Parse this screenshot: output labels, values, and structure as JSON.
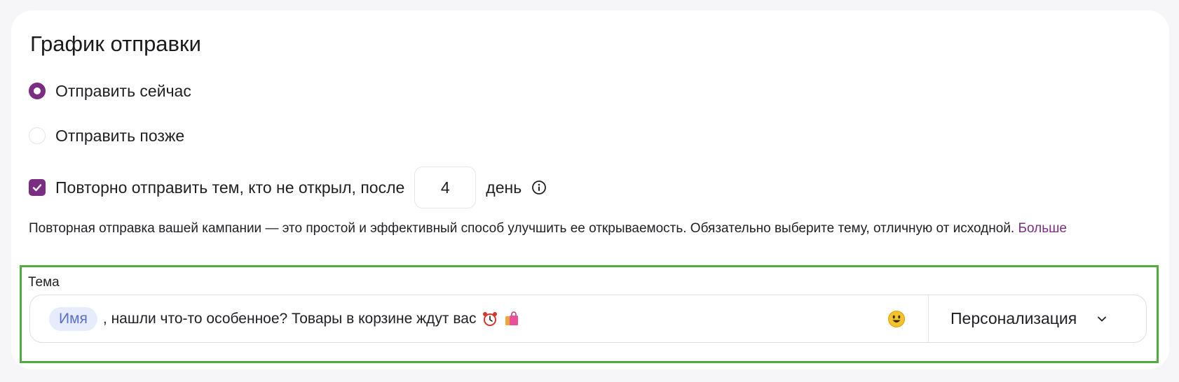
{
  "schedule": {
    "title": "График отправки",
    "options": [
      {
        "label": "Отправить сейчас",
        "selected": true
      },
      {
        "label": "Отправить позже",
        "selected": false
      }
    ]
  },
  "resend": {
    "checked": true,
    "label": "Повторно отправить тем, кто не открыл, после",
    "days_value": "4",
    "unit": "день",
    "icon": "info-icon",
    "description": "Повторная отправка вашей кампании — это простой и эффективный способ улучшить ее открываемость. Обязательно выберите тему, отличную от исходной.",
    "more_link": "Больше"
  },
  "subject": {
    "label": "Тема",
    "merge_tag": "Имя",
    "text": ", нашли что-то особенное? Товары в корзине ждут вас",
    "trailing_icons": [
      "alarm-clock-icon",
      "shopping-bags-icon"
    ],
    "emoji_button_icon": "smiley-icon",
    "personalization_label": "Персонализация"
  },
  "colors": {
    "accent": "#7b2d83",
    "highlight_border": "#52ab3e",
    "chip_bg": "#e6ecfb",
    "chip_text": "#5a6ec7",
    "link": "#7b2d83"
  }
}
